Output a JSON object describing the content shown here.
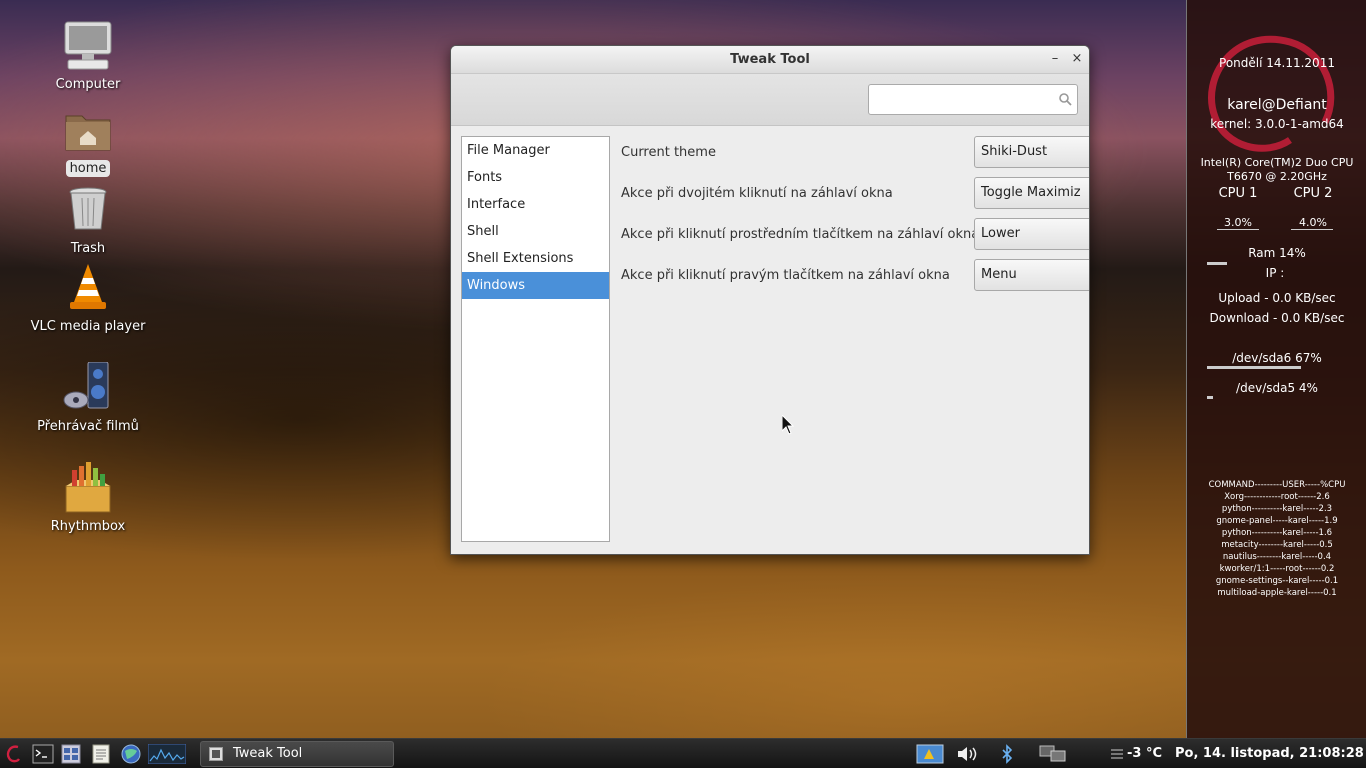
{
  "desktop": {
    "icons": [
      {
        "label": "Computer"
      },
      {
        "label": "home"
      },
      {
        "label": "Trash"
      },
      {
        "label": "VLC media player"
      },
      {
        "label": "Přehrávač filmů"
      },
      {
        "label": "Rhythmbox"
      }
    ]
  },
  "window": {
    "title": "Tweak Tool",
    "minimize_glyph": "–",
    "close_glyph": "×",
    "search": {
      "value": "",
      "placeholder": ""
    },
    "sidebar": [
      {
        "label": "File Manager"
      },
      {
        "label": "Fonts"
      },
      {
        "label": "Interface"
      },
      {
        "label": "Shell"
      },
      {
        "label": "Shell Extensions"
      },
      {
        "label": "Windows"
      }
    ],
    "active_sidebar": "Windows",
    "settings": [
      {
        "label": "Current theme",
        "value": "Shiki-Dust"
      },
      {
        "label": "Akce při dvojitém kliknutí na záhlaví okna",
        "value": "Toggle Maximiz"
      },
      {
        "label": "Akce při kliknutí prostředním tlačítkem na záhlaví okna",
        "value": "Lower"
      },
      {
        "label": "Akce při kliknutí pravým tlačítkem na záhlaví okna",
        "value": "Menu"
      }
    ]
  },
  "conky": {
    "date": "Pondělí 14.11.2011",
    "user": "karel@Defiant",
    "kernel": "kernel: 3.0.0-1-amd64",
    "cpu_model": "Intel(R) Core(TM)2 Duo CPU",
    "cpu_speed": "T6670  @ 2.20GHz",
    "cpu1_label": "CPU 1",
    "cpu2_label": "CPU 2",
    "cpu1_value": "3.0%",
    "cpu2_value": "4.0%",
    "ram": "Ram 14%",
    "ram_fraction": 0.14,
    "ip": "IP :",
    "upload": "Upload - 0.0 KB/sec",
    "download": "Download - 0.0 KB/sec",
    "sda6": "/dev/sda6 67%",
    "sda6_fraction": 0.67,
    "sda5": "/dev/sda5 4%",
    "sda5_fraction": 0.04,
    "process_header": "COMMAND---------USER-----%CPU",
    "processes": [
      "Xorg------------root------2.6",
      "python----------karel-----2.3",
      "gnome-panel-----karel-----1.9",
      "python----------karel-----1.6",
      "metacity--------karel-----0.5",
      "nautilus--------karel-----0.4",
      "kworker/1:1-----root------0.2",
      "gnome-settings--karel-----0.1",
      "multiload-apple-karel-----0.1"
    ]
  },
  "taskbar": {
    "task_label": "Tweak Tool",
    "temperature": "-3 °C",
    "clock": "Po, 14. listopad, 21:08:28"
  }
}
